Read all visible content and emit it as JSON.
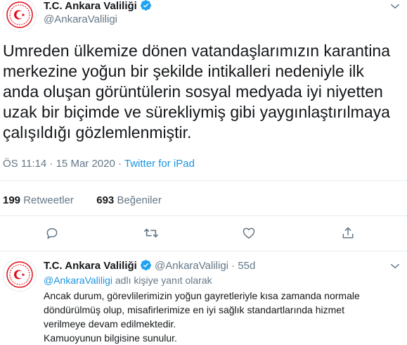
{
  "tweet": {
    "author_name": "T.C. Ankara Valiliği",
    "author_handle": "@AnkaraValiligi",
    "text": "Umreden ülkemize dönen vatandaşlarımızın karantina\nmerkezine yoğun bir şekilde intikalleri nedeniyle ilk\nanda oluşan görüntülerin sosyal medyada iyi niyetten\nuzak bir biçimde ve sürekliymiş gibi yaygınlaştırılmaya\nçalışıldığı gözlemlenmiştir.",
    "timestamp": "ÖS 11:14 · 15 Mar 2020",
    "separator": " · ",
    "source": "Twitter for iPad",
    "retweets_count": "199",
    "retweets_label": "Retweetler",
    "likes_count": "693",
    "likes_label": "Beğeniler"
  },
  "reply": {
    "author_name": "T.C. Ankara Valiliği",
    "author_handle": "@AnkaraValiligi",
    "age": "55d",
    "dot": "·",
    "reply_to_mention": "@AnkaraValiligi",
    "reply_to_suffix": "adlı kişiye yanıt olarak",
    "text": "Ancak durum, görevlilerimizin yoğun gayretleriyle kısa zamanda normale\ndöndürülmüş olup, misafirlerimize en iyi sağlık standartlarında hizmet\nverilmeye devam edilmektedir.\nKamuoyunun bilgisine sunulur."
  },
  "icons": {
    "verified": "verified-badge-icon",
    "chevron": "chevron-down-icon",
    "reply": "reply-icon",
    "retweet": "retweet-icon",
    "like": "heart-icon",
    "share": "share-icon"
  },
  "colors": {
    "accent": "#1b95e0",
    "verified": "#1da1f2",
    "muted": "#657786",
    "emblem": "#e30a17"
  }
}
